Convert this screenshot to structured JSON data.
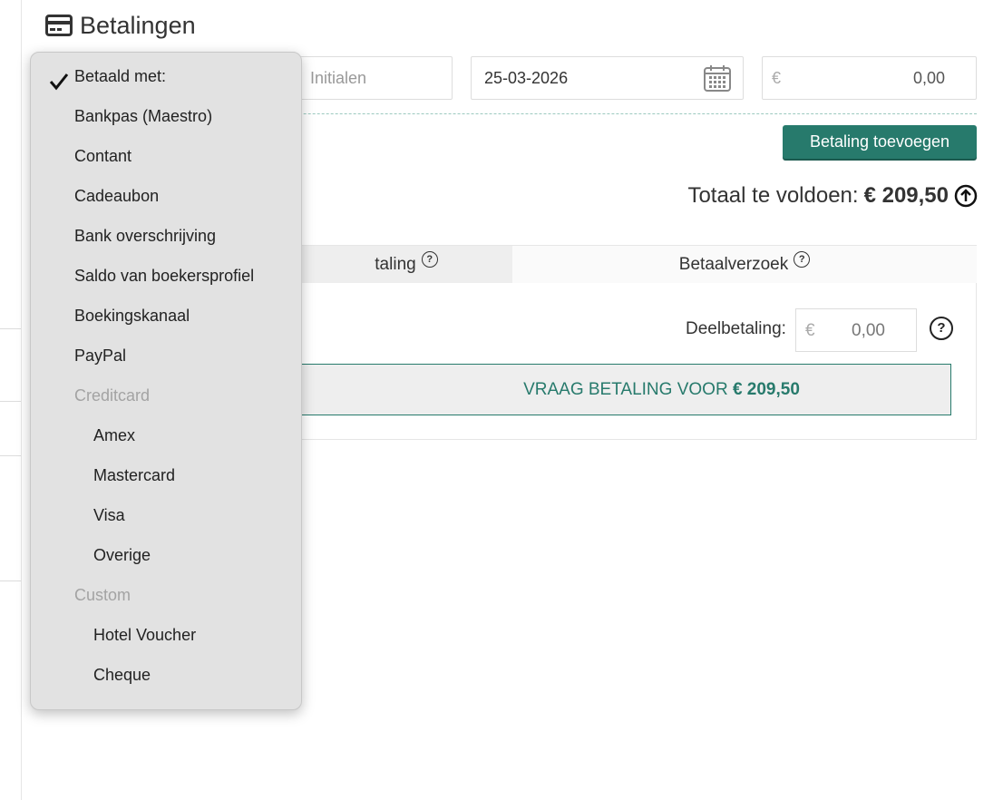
{
  "header": {
    "title": "Betalingen",
    "icon": "credit-card-icon"
  },
  "form": {
    "initials_placeholder": "Initialen",
    "date_value": "25-03-2026",
    "amount_currency": "€",
    "amount_value": "0,00"
  },
  "actions": {
    "add_payment_label": "Betaling toevoegen"
  },
  "total": {
    "label": "Totaal te voldoen:",
    "amount": "€ 209,50"
  },
  "tabs": [
    {
      "label": "taling"
    },
    {
      "label": "Betaalverzoek"
    }
  ],
  "tab_help_glyph": "?",
  "partial": {
    "label": "Deelbetaling:",
    "currency": "€",
    "value": "0,00"
  },
  "request": {
    "label": "VRAAG BETALING VOOR",
    "amount": "€ 209,50"
  },
  "dropdown": {
    "selected": "Betaald met:",
    "items": [
      {
        "label": "Betaald met:"
      },
      {
        "label": "Bankpas (Maestro)"
      },
      {
        "label": "Contant"
      },
      {
        "label": "Cadeaubon"
      },
      {
        "label": "Bank overschrijving"
      },
      {
        "label": "Saldo van boekersprofiel"
      },
      {
        "label": "Boekingskanaal"
      },
      {
        "label": "PayPal"
      },
      {
        "label": "Creditcard"
      },
      {
        "label": "Amex"
      },
      {
        "label": "Mastercard"
      },
      {
        "label": "Visa"
      },
      {
        "label": "Overige"
      },
      {
        "label": "Custom"
      },
      {
        "label": "Hotel Voucher"
      },
      {
        "label": "Cheque"
      }
    ]
  },
  "colors": {
    "accent": "#277a6c",
    "muted": "#a3a3a3",
    "dropdown_bg": "#e2e2e2"
  }
}
